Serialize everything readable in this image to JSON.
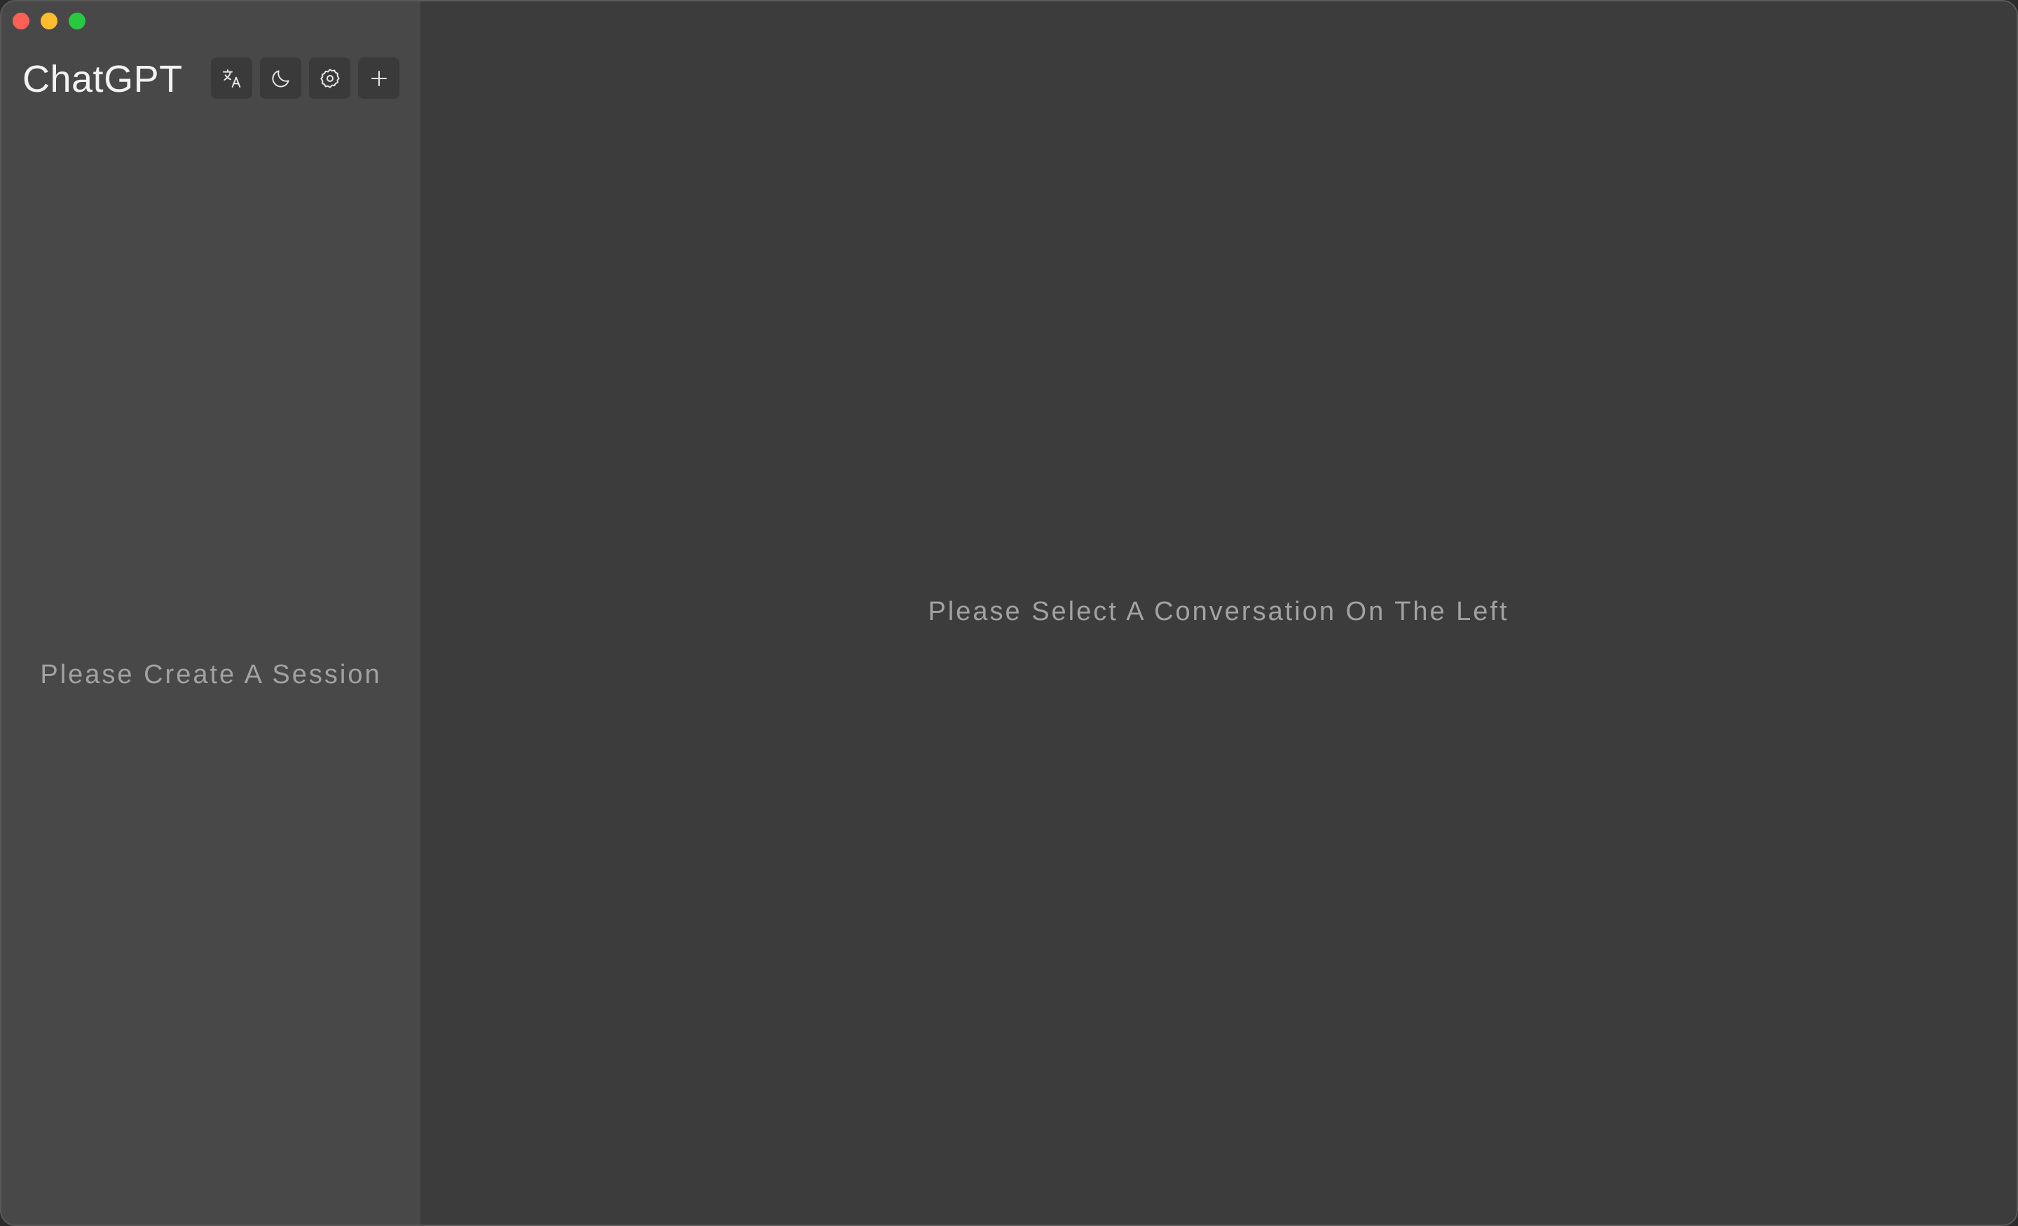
{
  "window": {
    "controls": [
      {
        "name": "close",
        "color": "#fe5f57"
      },
      {
        "name": "minimize",
        "color": "#febc2e"
      },
      {
        "name": "maximize",
        "color": "#28c840"
      }
    ]
  },
  "sidebar": {
    "title": "ChatGPT",
    "toolbar": [
      {
        "name": "translate",
        "icon": "translate-icon"
      },
      {
        "name": "theme",
        "icon": "moon-icon"
      },
      {
        "name": "settings",
        "icon": "gear-icon"
      },
      {
        "name": "new-session",
        "icon": "plus-icon"
      }
    ],
    "empty_message": "Please Create A Session"
  },
  "main": {
    "empty_message": "Please Select A Conversation On The Left"
  },
  "colors": {
    "sidebar_bg": "#484848",
    "main_bg": "#3c3c3c",
    "button_bg": "#3a3a3a",
    "muted_text": "#a2a2a2",
    "title_text": "#f2f2f2"
  }
}
